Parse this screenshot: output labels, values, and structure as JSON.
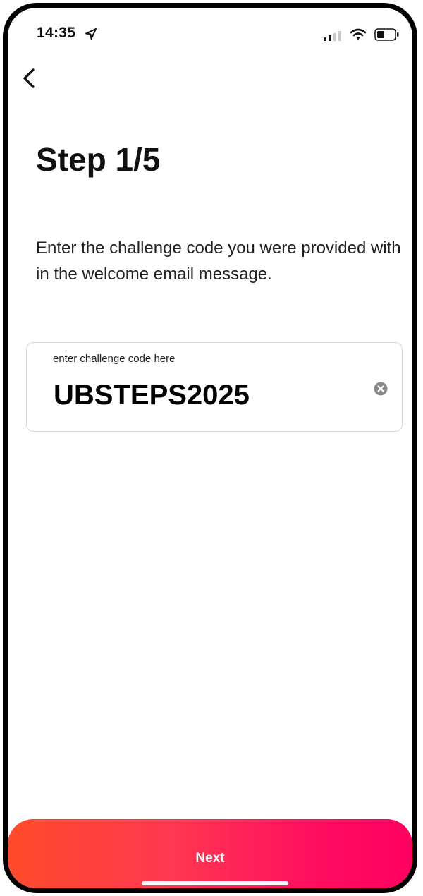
{
  "status_bar": {
    "time": "14:35",
    "icons": [
      "location-arrow-icon",
      "cellular-signal-icon",
      "wifi-icon",
      "battery-icon"
    ]
  },
  "navigation": {
    "back_icon": "chevron-left-icon"
  },
  "header": {
    "title": "Step 1/5"
  },
  "main": {
    "instructions": "Enter the challenge code you were provided with in the welcome email message.",
    "code_field": {
      "label": "enter challenge code here",
      "value": "UBSTEPS2025",
      "clear_icon": "clear-circle-icon"
    }
  },
  "footer": {
    "next_label": "Next"
  },
  "colors": {
    "gradient_start": "#ff4b2b",
    "gradient_end": "#ff0060",
    "text": "#111111",
    "field_border": "#d6d6d6"
  }
}
